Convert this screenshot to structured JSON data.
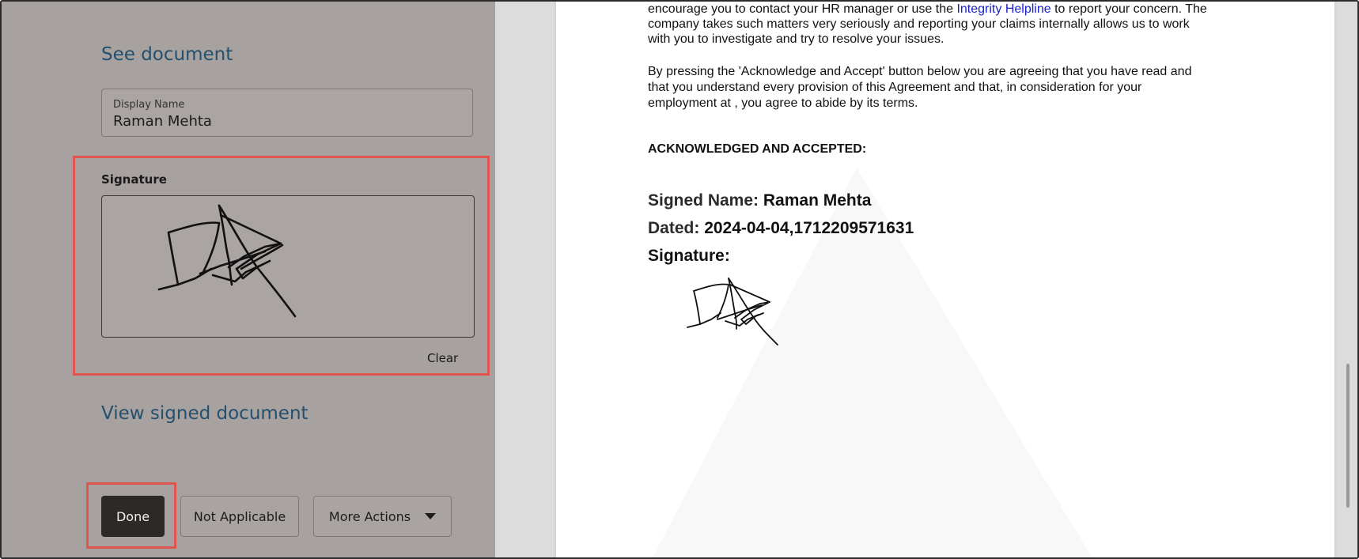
{
  "left_panel": {
    "see_document": "See document",
    "display_name": {
      "label": "Display Name",
      "value": "Raman Mehta"
    },
    "signature": {
      "title": "Signature",
      "clear_label": "Clear"
    },
    "view_signed_document": "View signed document",
    "actions": {
      "done": "Done",
      "not_applicable": "Not Applicable",
      "more_actions": "More Actions"
    }
  },
  "document": {
    "para1": {
      "line1_before": "encourage you to contact your HR manager or use the ",
      "line1_link": "Integrity Helpline",
      "line1_after": " to report your concern. The",
      "line2": "company takes such matters very seriously and reporting your claims internally allows us to work",
      "line3": "with you to investigate and try to resolve your issues."
    },
    "para2": {
      "line1": "By pressing the 'Acknowledge and Accept' button below you are agreeing that you have read and",
      "line2": "that you understand every provision of this Agreement and that, in consideration for your",
      "line3": "employment at , you agree to abide by its terms."
    },
    "acknowledged": "ACKNOWLEDGED AND ACCEPTED:",
    "signed_name_label": "Signed Name:",
    "signed_name_value": "Raman Mehta",
    "dated_label": "Dated:",
    "dated_value": "2024-04-04,1712209571631",
    "signature_label": "Signature:"
  },
  "colors": {
    "highlight": "#e1554f",
    "link": "#24506d",
    "doc_link": "#1a22c7"
  }
}
